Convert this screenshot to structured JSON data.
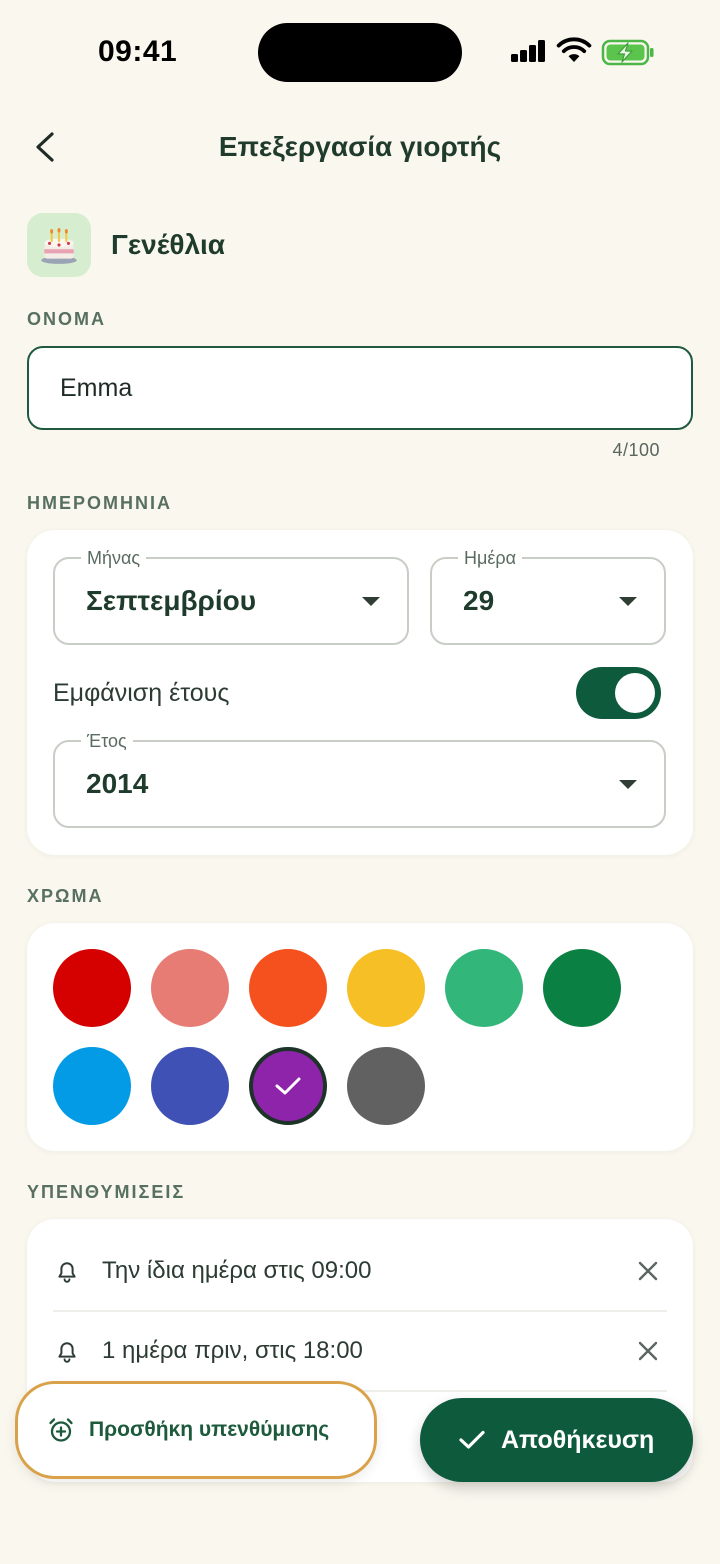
{
  "theme": {
    "primary": "#0E5A3D",
    "highlight": "#D9A24A",
    "background": "#F9F7EE"
  },
  "status_bar": {
    "time": "09:41",
    "icons": [
      "signal-icon",
      "wifi-icon",
      "battery-charging-icon"
    ]
  },
  "header": {
    "back_icon": "chevron-left-icon",
    "title": "Επεξεργασία γιορτής"
  },
  "category": {
    "icon": "birthday-cake-icon",
    "label": "Γενέθλια"
  },
  "name_section": {
    "label": "ΟΝΟΜΑ",
    "value": "Emma",
    "counter": "4/100"
  },
  "date_section": {
    "label": "ΗΜΕΡΟΜΗΝΙΑ",
    "month": {
      "label": "Μήνας",
      "value": "Σεπτεμβρίου"
    },
    "day": {
      "label": "Ημέρα",
      "value": "29"
    },
    "show_year": {
      "label": "Εμφάνιση έτους",
      "on": true
    },
    "year": {
      "label": "Έτος",
      "value": "2014"
    }
  },
  "color_section": {
    "label": "ΧΡΩΜΑ",
    "colors": [
      "#D50000",
      "#E67C73",
      "#F4511E",
      "#F6BF26",
      "#33B679",
      "#0B8043",
      "#039BE5",
      "#3F51B5",
      "#8E24AA",
      "#616161"
    ],
    "selected_index": 8
  },
  "reminders_section": {
    "label": "ΥΠΕΝΘΥΜΙΣΕΙΣ",
    "items": [
      {
        "text": "Την ίδια ημέρα στις 09:00",
        "icon": "bell-icon"
      },
      {
        "text": "1 ημέρα πριν, στις 18:00",
        "icon": "bell-icon"
      }
    ],
    "add_label": "Προσθήκη υπενθύμισης",
    "add_icon": "alarm-add-icon"
  },
  "save_button": {
    "label": "Αποθήκευση",
    "icon": "check-icon"
  }
}
